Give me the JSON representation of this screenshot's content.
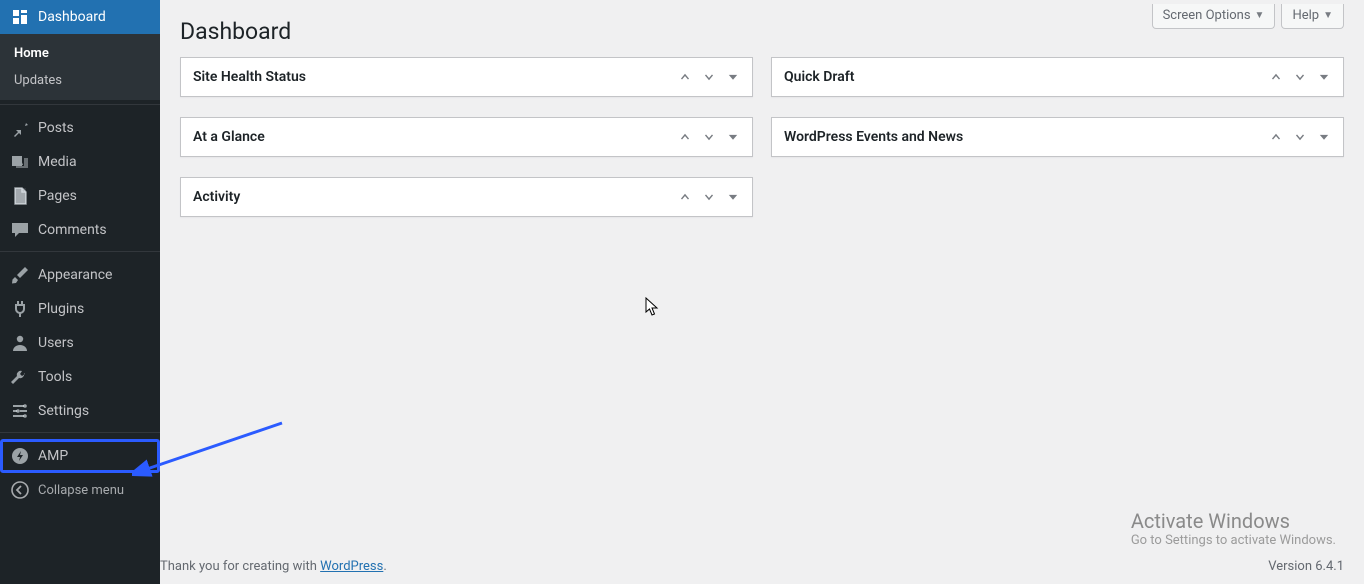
{
  "topbar": {
    "screen_options": "Screen Options",
    "help": "Help"
  },
  "page": {
    "title": "Dashboard"
  },
  "sidebar": {
    "items": [
      {
        "id": "dashboard",
        "label": "Dashboard",
        "icon": "dashboard",
        "current": true,
        "submenu": [
          {
            "id": "home",
            "label": "Home",
            "current": true
          },
          {
            "id": "updates",
            "label": "Updates",
            "current": false
          }
        ]
      },
      {
        "sep": true
      },
      {
        "id": "posts",
        "label": "Posts",
        "icon": "pin"
      },
      {
        "id": "media",
        "label": "Media",
        "icon": "media"
      },
      {
        "id": "pages",
        "label": "Pages",
        "icon": "pages"
      },
      {
        "id": "comments",
        "label": "Comments",
        "icon": "comment"
      },
      {
        "sep": true
      },
      {
        "id": "appearance",
        "label": "Appearance",
        "icon": "brush"
      },
      {
        "id": "plugins",
        "label": "Plugins",
        "icon": "plug"
      },
      {
        "id": "users",
        "label": "Users",
        "icon": "user"
      },
      {
        "id": "tools",
        "label": "Tools",
        "icon": "wrench"
      },
      {
        "id": "settings",
        "label": "Settings",
        "icon": "settings"
      },
      {
        "sep": true
      },
      {
        "id": "amp",
        "label": "AMP",
        "icon": "amp",
        "highlight": true
      },
      {
        "id": "collapse",
        "label": "Collapse menu",
        "icon": "collapse",
        "collapse": true
      }
    ]
  },
  "widgets": {
    "left": [
      {
        "id": "site_health",
        "title": "Site Health Status"
      },
      {
        "id": "at_a_glance",
        "title": "At a Glance"
      },
      {
        "id": "activity",
        "title": "Activity"
      }
    ],
    "right": [
      {
        "id": "quick_draft",
        "title": "Quick Draft"
      },
      {
        "id": "events_news",
        "title": "WordPress Events and News"
      }
    ]
  },
  "footer": {
    "prefix": "Thank you for creating with ",
    "link_text": "WordPress",
    "suffix": ".",
    "version": "Version 6.4.1"
  },
  "watermark": {
    "line1": "Activate Windows",
    "line2": "Go to Settings to activate Windows."
  }
}
